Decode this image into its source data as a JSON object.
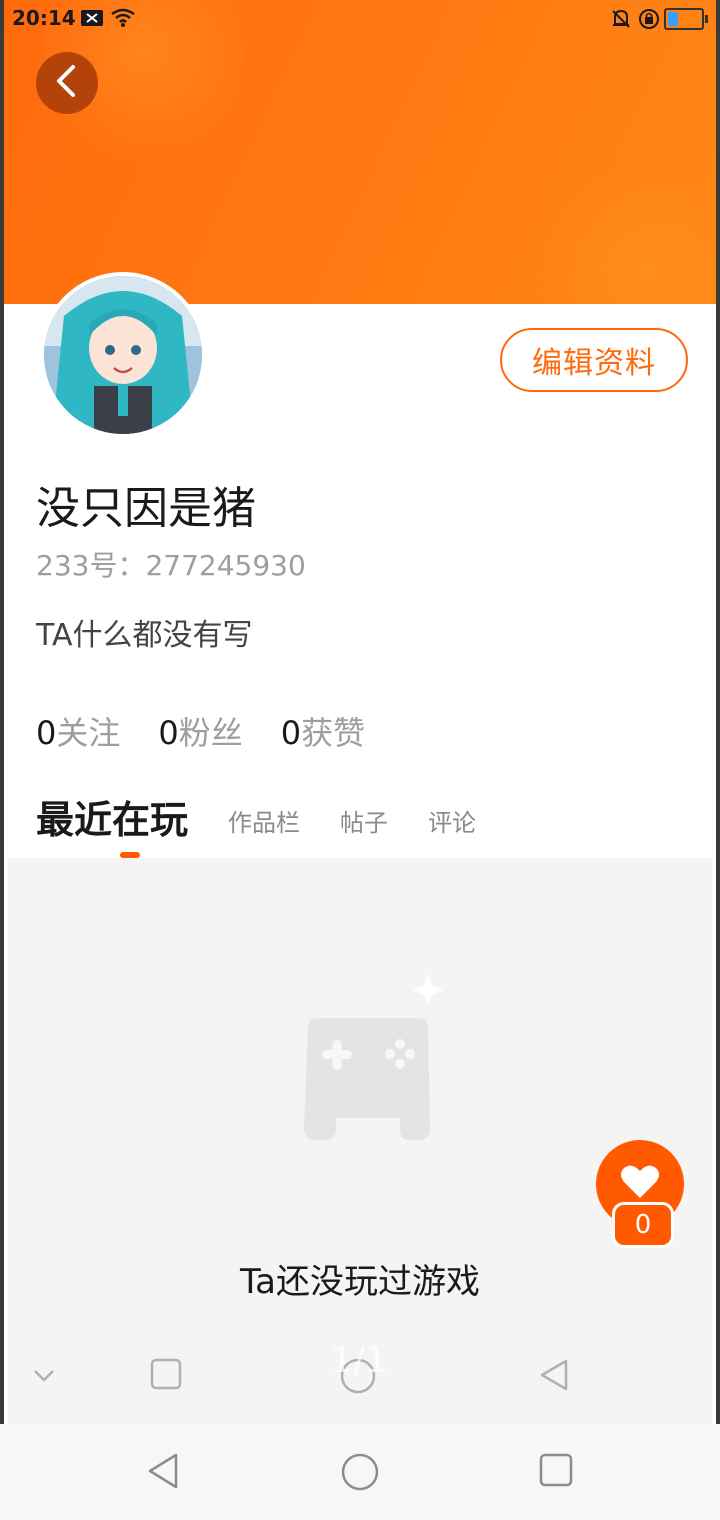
{
  "status_bar": {
    "time": "20:14",
    "icons_left": [
      "notification-x-icon",
      "wifi-icon"
    ],
    "icons_right": [
      "bell-muted-icon",
      "rotation-lock-icon",
      "battery-icon"
    ]
  },
  "header": {
    "back_icon": "chevron-left-icon",
    "banner_color": "#ff7a12"
  },
  "profile": {
    "edit_label": "编辑资料",
    "username": "没只因是猪",
    "uid_text": "233号：277245930",
    "bio": "TA什么都没有写",
    "stats": [
      {
        "num": "0",
        "label": "关注"
      },
      {
        "num": "0",
        "label": "粉丝"
      },
      {
        "num": "0",
        "label": "获赞"
      }
    ]
  },
  "tabs": [
    {
      "label": "最近在玩",
      "active": true
    },
    {
      "label": "作品栏",
      "active": false
    },
    {
      "label": "帖子",
      "active": false
    },
    {
      "label": "评论",
      "active": false
    }
  ],
  "empty_state": {
    "icon": "gamepad-icon",
    "text": "Ta还没玩过游戏"
  },
  "like": {
    "icon": "heart-icon",
    "count": "0"
  },
  "inner_nav": {
    "page_indicator": "1/1",
    "items": [
      "chevron-down-icon",
      "square-icon",
      "circle-icon",
      "triangle-back-icon"
    ]
  },
  "system_nav": {
    "items": [
      "back-icon",
      "home-icon",
      "recents-icon"
    ]
  },
  "colors": {
    "accent": "#ff5a00",
    "edit_border": "#ff6a0d",
    "muted_text": "#9e9e9e"
  }
}
